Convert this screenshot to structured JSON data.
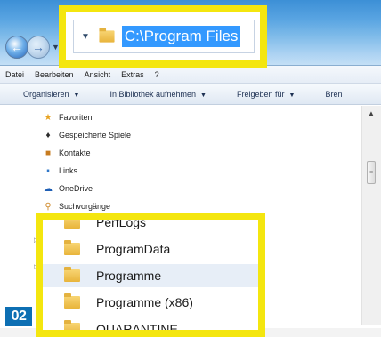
{
  "address_bar": {
    "path": "C:\\Program Files"
  },
  "menu": [
    "Datei",
    "Bearbeiten",
    "Ansicht",
    "Extras",
    "?"
  ],
  "commands": [
    {
      "label": "Organisieren"
    },
    {
      "label": "In Bibliothek aufnehmen"
    },
    {
      "label": "Freigeben für"
    },
    {
      "label": "Bren"
    }
  ],
  "nav_items": [
    {
      "label": "Favoriten",
      "icon": "star-icon"
    },
    {
      "label": "Gespeicherte Spiele",
      "icon": "games-icon"
    },
    {
      "label": "Kontakte",
      "icon": "contacts-icon"
    },
    {
      "label": "Links",
      "icon": "links-icon"
    },
    {
      "label": "OneDrive",
      "icon": "cloud-icon"
    },
    {
      "label": "Suchvorgänge",
      "icon": "search-icon"
    }
  ],
  "folders": [
    {
      "name": "PerfLogs",
      "selected": false
    },
    {
      "name": "ProgramData",
      "selected": false
    },
    {
      "name": "Programme",
      "selected": true
    },
    {
      "name": "Programme (x86)",
      "selected": false
    },
    {
      "name": "QUARANTINE",
      "selected": false
    }
  ],
  "step_badge": "02",
  "colors": {
    "highlight": "#f4e60f",
    "selection": "#3399ff",
    "badge": "#0d6fb3"
  }
}
